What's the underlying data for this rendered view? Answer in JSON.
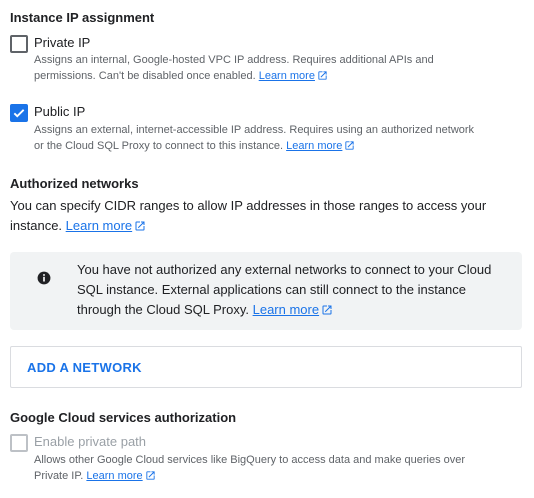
{
  "instance_ip": {
    "heading": "Instance IP assignment",
    "private_ip": {
      "label": "Private IP",
      "checked": false,
      "desc_line1": "Assigns an internal, Google-hosted VPC IP address. Requires additional APIs and",
      "desc_line2": "permissions. Can't be disabled once enabled.",
      "learn_more": "Learn more"
    },
    "public_ip": {
      "label": "Public IP",
      "checked": true,
      "desc_line1": "Assigns an external, internet-accessible IP address. Requires using an authorized network",
      "desc_line2": "or the Cloud SQL Proxy to connect to this instance.",
      "learn_more": "Learn more"
    }
  },
  "authorized_networks": {
    "heading": "Authorized networks",
    "desc_line1": "You can specify CIDR ranges to allow IP addresses in those ranges to access your",
    "desc_line2": "instance.",
    "learn_more": "Learn more",
    "info": {
      "icon": "info-icon",
      "line1": "You have not authorized any external networks to connect to your Cloud",
      "line2": "SQL instance. External applications can still connect to the instance",
      "line3": "through the Cloud SQL Proxy.",
      "learn_more": "Learn more"
    },
    "add_button": "ADD A NETWORK"
  },
  "gcs_auth": {
    "heading": "Google Cloud services authorization",
    "private_path": {
      "label": "Enable private path",
      "checked": false,
      "disabled": true,
      "desc_line1": "Allows other Google Cloud services like BigQuery to access data and make queries over",
      "desc_line2": "Private IP.",
      "learn_more": "Learn more"
    }
  },
  "colors": {
    "accent": "#1a73e8",
    "text": "#202124",
    "secondary": "#5f6368",
    "box_bg": "#f1f3f4"
  }
}
